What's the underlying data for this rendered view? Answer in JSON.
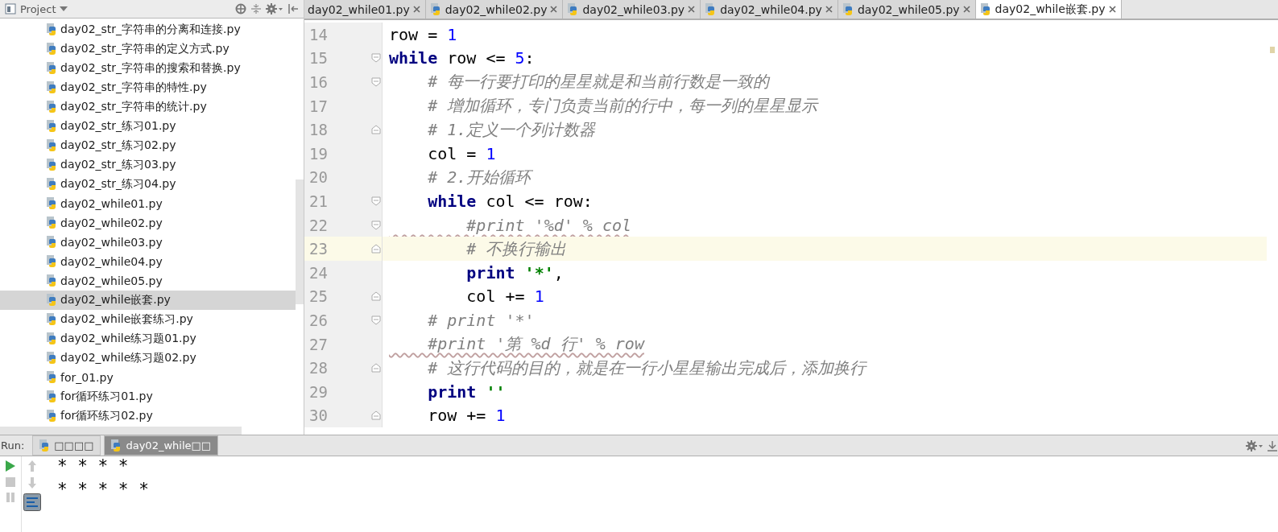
{
  "project_panel": {
    "title": "Project",
    "items": [
      {
        "label": "day02_str_字符串的分离和连接.py",
        "selected": false
      },
      {
        "label": "day02_str_字符串的定义方式.py",
        "selected": false
      },
      {
        "label": "day02_str_字符串的搜索和替换.py",
        "selected": false
      },
      {
        "label": "day02_str_字符串的特性.py",
        "selected": false
      },
      {
        "label": "day02_str_字符串的统计.py",
        "selected": false
      },
      {
        "label": "day02_str_练习01.py",
        "selected": false
      },
      {
        "label": "day02_str_练习02.py",
        "selected": false
      },
      {
        "label": "day02_str_练习03.py",
        "selected": false
      },
      {
        "label": "day02_str_练习04.py",
        "selected": false
      },
      {
        "label": "day02_while01.py",
        "selected": false
      },
      {
        "label": "day02_while02.py",
        "selected": false
      },
      {
        "label": "day02_while03.py",
        "selected": false
      },
      {
        "label": "day02_while04.py",
        "selected": false
      },
      {
        "label": "day02_while05.py",
        "selected": false
      },
      {
        "label": "day02_while嵌套.py",
        "selected": true
      },
      {
        "label": "day02_while嵌套练习.py",
        "selected": false
      },
      {
        "label": "day02_while练习题01.py",
        "selected": false
      },
      {
        "label": "day02_while练习题02.py",
        "selected": false
      },
      {
        "label": "for_01.py",
        "selected": false
      },
      {
        "label": "for循环练习01.py",
        "selected": false
      },
      {
        "label": "for循环练习02.py",
        "selected": false
      }
    ]
  },
  "editor_tabs": [
    {
      "label": "day02_while01.py",
      "selected": false
    },
    {
      "label": "day02_while02.py",
      "selected": false
    },
    {
      "label": "day02_while03.py",
      "selected": false
    },
    {
      "label": "day02_while04.py",
      "selected": false
    },
    {
      "label": "day02_while05.py",
      "selected": false
    },
    {
      "label": "day02_while嵌套.py",
      "selected": true
    }
  ],
  "code_lines": [
    {
      "number": "14",
      "current": false,
      "tokens": [
        {
          "kind": "plain",
          "text": "row = "
        },
        {
          "kind": "number",
          "text": "1"
        }
      ]
    },
    {
      "number": "15",
      "current": false,
      "fold_start": true,
      "tokens": [
        {
          "kind": "keyword",
          "text": "while"
        },
        {
          "kind": "plain",
          "text": " row <= "
        },
        {
          "kind": "number",
          "text": "5"
        },
        {
          "kind": "plain",
          "text": ":"
        }
      ]
    },
    {
      "number": "16",
      "current": false,
      "fold_start": true,
      "tokens": [
        {
          "kind": "comment",
          "text": "    # 每一行要打印的星星就是和当前行数是一致的"
        }
      ]
    },
    {
      "number": "17",
      "current": false,
      "tokens": [
        {
          "kind": "comment",
          "text": "    # 增加循环，专门负责当前的行中，每一列的星星显示"
        }
      ]
    },
    {
      "number": "18",
      "current": false,
      "fold_end": true,
      "tokens": [
        {
          "kind": "comment",
          "text": "    # 1.定义一个列计数器"
        }
      ]
    },
    {
      "number": "19",
      "current": false,
      "tokens": [
        {
          "kind": "plain",
          "text": "    col = "
        },
        {
          "kind": "number",
          "text": "1"
        }
      ]
    },
    {
      "number": "20",
      "current": false,
      "tokens": [
        {
          "kind": "comment",
          "text": "    # 2.开始循环"
        }
      ]
    },
    {
      "number": "21",
      "current": false,
      "fold_start": true,
      "tokens": [
        {
          "kind": "keyword",
          "text": "    while"
        },
        {
          "kind": "plain",
          "text": " col <= row:"
        }
      ]
    },
    {
      "number": "22",
      "current": false,
      "fold_start": true,
      "wavy": true,
      "tokens": [
        {
          "kind": "comment",
          "text": "        #print '%d' % col"
        }
      ]
    },
    {
      "number": "23",
      "current": true,
      "fold_end": true,
      "tokens": [
        {
          "kind": "comment",
          "text": "        # 不换行输出"
        }
      ]
    },
    {
      "number": "24",
      "current": false,
      "tokens": [
        {
          "kind": "keyword",
          "text": "        print"
        },
        {
          "kind": "string",
          "text": " '*'"
        },
        {
          "kind": "plain",
          "text": ","
        }
      ]
    },
    {
      "number": "25",
      "current": false,
      "fold_end": true,
      "tokens": [
        {
          "kind": "plain",
          "text": "        col += "
        },
        {
          "kind": "number",
          "text": "1"
        }
      ]
    },
    {
      "number": "26",
      "current": false,
      "fold_start": true,
      "tokens": [
        {
          "kind": "comment",
          "text": "    # print '*'"
        }
      ]
    },
    {
      "number": "27",
      "current": false,
      "wavy": true,
      "tokens": [
        {
          "kind": "comment",
          "text": "    #print '第 %d 行' % row"
        }
      ]
    },
    {
      "number": "28",
      "current": false,
      "fold_end": true,
      "tokens": [
        {
          "kind": "comment",
          "text": "    # 这行代码的目的，就是在一行小星星输出完成后，添加换行"
        }
      ]
    },
    {
      "number": "29",
      "current": false,
      "tokens": [
        {
          "kind": "keyword",
          "text": "    print"
        },
        {
          "kind": "string",
          "text": " ''"
        }
      ]
    },
    {
      "number": "30",
      "current": false,
      "fold_end": true,
      "tokens": [
        {
          "kind": "plain",
          "text": "    row += "
        },
        {
          "kind": "number",
          "text": "1"
        }
      ]
    }
  ],
  "run_panel": {
    "label": "Run:",
    "tabs": [
      {
        "label": "□□□□",
        "selected": false
      },
      {
        "label": "day02_while□□",
        "selected": true
      }
    ],
    "output": [
      "* * * *",
      "* * * * *"
    ]
  }
}
